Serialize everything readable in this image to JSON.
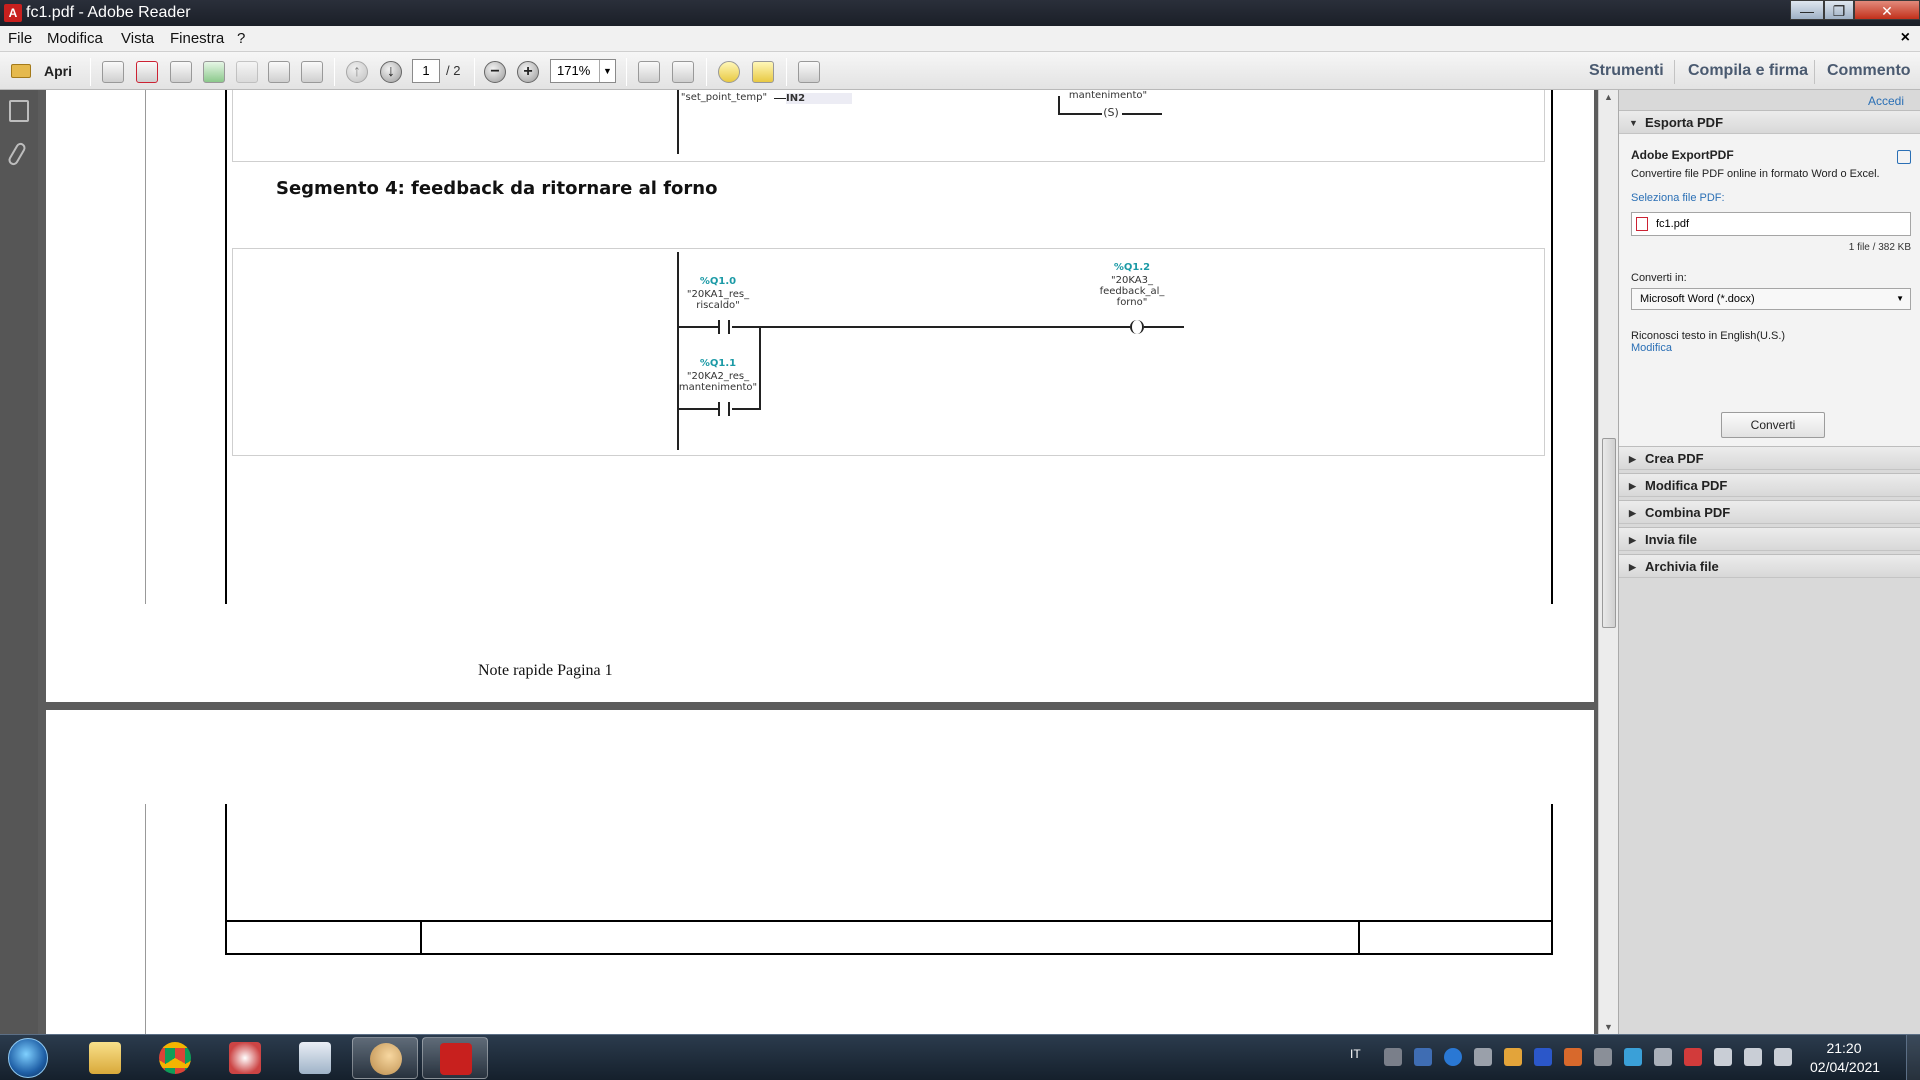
{
  "window": {
    "title": "fc1.pdf - Adobe Reader",
    "app_icon": "adobe-reader-icon",
    "controls": [
      "minimize",
      "maximize",
      "close"
    ]
  },
  "menu": {
    "items": [
      "File",
      "Modifica",
      "Vista",
      "Finestra",
      "?"
    ],
    "close_glyph": "×"
  },
  "toolbar": {
    "open_label": "Apri",
    "page_current": "1",
    "page_total": "/ 2",
    "zoom": "171%",
    "right_items": [
      "Strumenti",
      "Compila e firma",
      "Commento"
    ]
  },
  "document": {
    "segment_title": "Segmento 4: feedback da ritornare al forno",
    "top_fragment": {
      "set_point": "\"set_point_temp\"",
      "in2": "IN2",
      "mantenimento": "mantenimento\"",
      "coil_s": "S"
    },
    "contact1": {
      "addr": "%Q1.0",
      "name1": "\"20KA1_res_",
      "name2": "riscaldo\""
    },
    "contact2": {
      "addr": "%Q1.1",
      "name1": "\"20KA2_res_",
      "name2": "mantenimento\""
    },
    "coil": {
      "addr": "%Q1.2",
      "name1": "\"20KA3_",
      "name2": "feedback_al_",
      "name3": "forno\""
    },
    "footer_note": "Note rapide Pagina 1"
  },
  "right_panel": {
    "signin": "Accedi",
    "export_header": "Esporta PDF",
    "export_title": "Adobe ExportPDF",
    "export_desc": "Convertire file PDF online in formato Word o Excel.",
    "select_file_label": "Seleziona file PDF:",
    "file_name": "fc1.pdf",
    "file_info": "1 file / 382 KB",
    "convert_to_label": "Converti in:",
    "convert_to_value": "Microsoft Word (*.docx)",
    "ocr_text": "Riconosci testo in English(U.S.)",
    "ocr_change": "Modifica",
    "convert_button": "Converti",
    "sections": [
      "Crea PDF",
      "Modifica PDF",
      "Combina PDF",
      "Invia file",
      "Archivia file"
    ]
  },
  "taskbar": {
    "language": "IT",
    "time": "21:20",
    "date": "02/04/2021",
    "apps": [
      "explorer-icon",
      "chrome-icon",
      "snipping-tool-icon",
      "calculator-icon",
      "paint-icon",
      "adobe-reader-icon"
    ]
  }
}
